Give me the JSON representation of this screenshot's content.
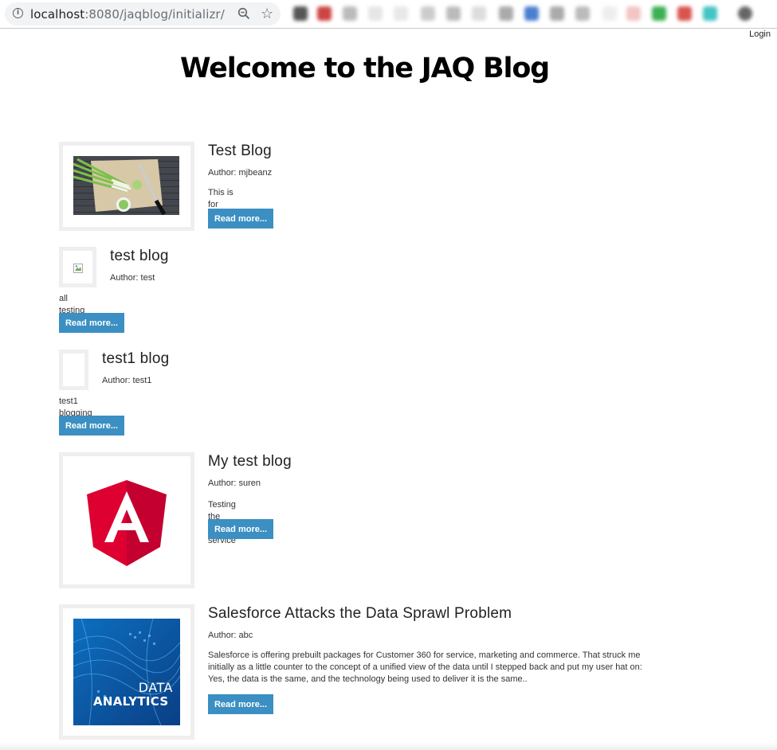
{
  "browser": {
    "url_host": "localhost",
    "url_path": ":8080/jaqblog/initializr/",
    "icons": [
      "info-icon",
      "zoom-icon",
      "star-icon"
    ]
  },
  "header": {
    "login": "Login",
    "title": "Welcome to the JAQ Blog"
  },
  "posts": [
    {
      "title": "Test Blog",
      "author": "Author: mjbeanz",
      "excerpt": "This is for testing",
      "button": "Read more...",
      "image": "green-onions-photo"
    },
    {
      "title": "test blog",
      "author": "Author: test",
      "excerpt": "all testing",
      "button": "Read more...",
      "image": "broken-image-icon"
    },
    {
      "title": "test1 blog",
      "author": "Author: test1",
      "excerpt": "test1 blogging",
      "button": "Read more...",
      "image": "empty-image"
    },
    {
      "title": "My test blog",
      "author": "Author: suren",
      "excerpt": "Testing the blog service",
      "button": "Read more...",
      "image": "angular-logo"
    },
    {
      "title": "Salesforce Attacks the Data Sprawl Problem",
      "author": "Author: abc",
      "excerpt": "Salesforce is offering prebuilt packages for Customer 360 for service, marketing and commerce. That struck me initially as a little counter to the concept of a unified view of the data until I stepped back and put my user hat on: Yes, the data is the same, and the technology being used to deliver it is the same..",
      "button": "Read more...",
      "image": "data-analytics-image",
      "image_text_1": "DATA",
      "image_text_2": "ANALYTICS"
    }
  ],
  "colors": {
    "button": "#3b8fc2",
    "angular_red": "#dd0031",
    "angular_dark_red": "#c3002f"
  }
}
